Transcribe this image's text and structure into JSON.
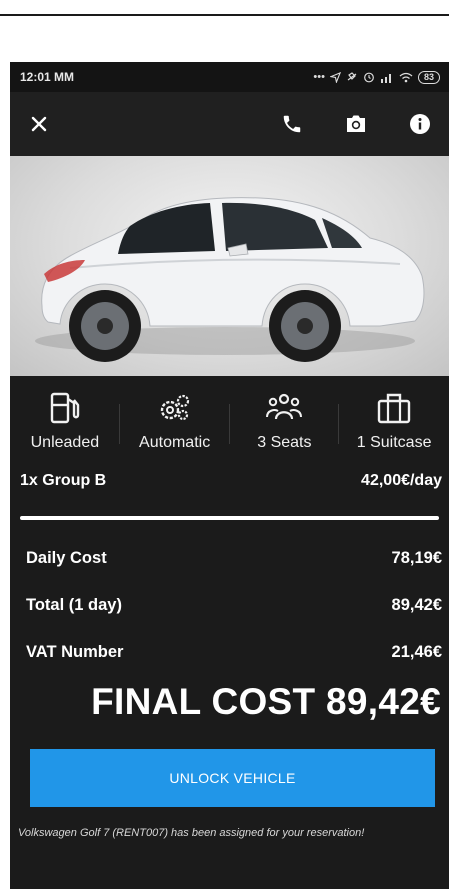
{
  "statusbar": {
    "time": "12:01 MM",
    "battery": "83",
    "signal_text": "... ✉ ★ ⏰ .∥∥"
  },
  "appbar": {
    "icons": [
      "close-icon",
      "phone-icon",
      "camera-icon",
      "info-icon"
    ]
  },
  "vehicle_image": "white-hatchback",
  "features": [
    {
      "icon": "fuel-pump-icon",
      "label": "Unleaded"
    },
    {
      "icon": "gears-icon",
      "label": "Automatic"
    },
    {
      "icon": "people-icon",
      "label": "3 Seats"
    },
    {
      "icon": "suitcase-icon",
      "label": "1 Suitcase"
    }
  ],
  "group": {
    "label": "1x Group B",
    "price": "42,00€/day"
  },
  "costs": [
    {
      "label": "Daily Cost",
      "value": "78,19€"
    },
    {
      "label": "Total (1 day)",
      "value": "89,42€"
    },
    {
      "label": "VAT Number",
      "value": "21,46€"
    }
  ],
  "final_cost": "FINAL COST 89,42€",
  "unlock_button": "UNLOCK VEHICLE",
  "footer_message": "Volkswagen Golf 7 (RENT007) has been assigned for your reservation!",
  "colors": {
    "accent": "#2196e8",
    "background": "#1b1b1b"
  }
}
